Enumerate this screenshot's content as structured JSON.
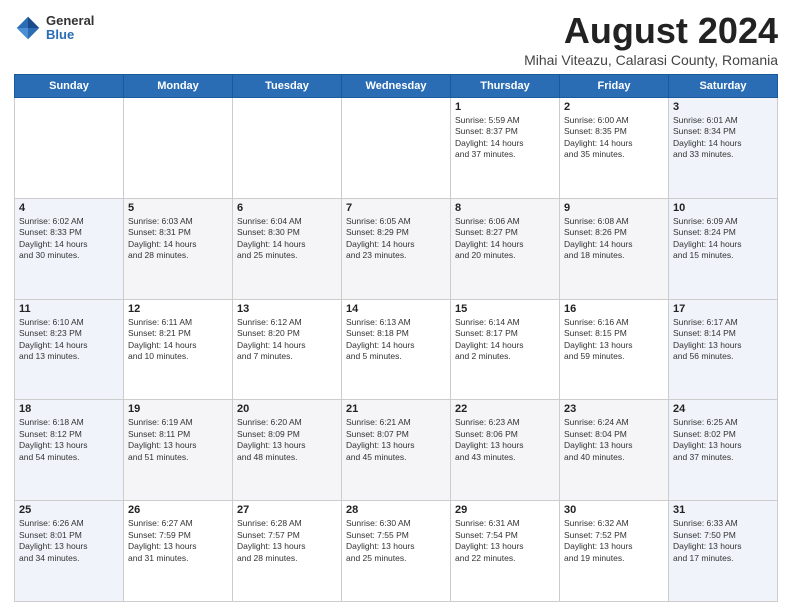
{
  "logo": {
    "general": "General",
    "blue": "Blue"
  },
  "title": "August 2024",
  "subtitle": "Mihai Viteazu, Calarasi County, Romania",
  "headers": [
    "Sunday",
    "Monday",
    "Tuesday",
    "Wednesday",
    "Thursday",
    "Friday",
    "Saturday"
  ],
  "weeks": [
    [
      {
        "day": "",
        "info": ""
      },
      {
        "day": "",
        "info": ""
      },
      {
        "day": "",
        "info": ""
      },
      {
        "day": "",
        "info": ""
      },
      {
        "day": "1",
        "info": "Sunrise: 5:59 AM\nSunset: 8:37 PM\nDaylight: 14 hours\nand 37 minutes."
      },
      {
        "day": "2",
        "info": "Sunrise: 6:00 AM\nSunset: 8:35 PM\nDaylight: 14 hours\nand 35 minutes."
      },
      {
        "day": "3",
        "info": "Sunrise: 6:01 AM\nSunset: 8:34 PM\nDaylight: 14 hours\nand 33 minutes."
      }
    ],
    [
      {
        "day": "4",
        "info": "Sunrise: 6:02 AM\nSunset: 8:33 PM\nDaylight: 14 hours\nand 30 minutes."
      },
      {
        "day": "5",
        "info": "Sunrise: 6:03 AM\nSunset: 8:31 PM\nDaylight: 14 hours\nand 28 minutes."
      },
      {
        "day": "6",
        "info": "Sunrise: 6:04 AM\nSunset: 8:30 PM\nDaylight: 14 hours\nand 25 minutes."
      },
      {
        "day": "7",
        "info": "Sunrise: 6:05 AM\nSunset: 8:29 PM\nDaylight: 14 hours\nand 23 minutes."
      },
      {
        "day": "8",
        "info": "Sunrise: 6:06 AM\nSunset: 8:27 PM\nDaylight: 14 hours\nand 20 minutes."
      },
      {
        "day": "9",
        "info": "Sunrise: 6:08 AM\nSunset: 8:26 PM\nDaylight: 14 hours\nand 18 minutes."
      },
      {
        "day": "10",
        "info": "Sunrise: 6:09 AM\nSunset: 8:24 PM\nDaylight: 14 hours\nand 15 minutes."
      }
    ],
    [
      {
        "day": "11",
        "info": "Sunrise: 6:10 AM\nSunset: 8:23 PM\nDaylight: 14 hours\nand 13 minutes."
      },
      {
        "day": "12",
        "info": "Sunrise: 6:11 AM\nSunset: 8:21 PM\nDaylight: 14 hours\nand 10 minutes."
      },
      {
        "day": "13",
        "info": "Sunrise: 6:12 AM\nSunset: 8:20 PM\nDaylight: 14 hours\nand 7 minutes."
      },
      {
        "day": "14",
        "info": "Sunrise: 6:13 AM\nSunset: 8:18 PM\nDaylight: 14 hours\nand 5 minutes."
      },
      {
        "day": "15",
        "info": "Sunrise: 6:14 AM\nSunset: 8:17 PM\nDaylight: 14 hours\nand 2 minutes."
      },
      {
        "day": "16",
        "info": "Sunrise: 6:16 AM\nSunset: 8:15 PM\nDaylight: 13 hours\nand 59 minutes."
      },
      {
        "day": "17",
        "info": "Sunrise: 6:17 AM\nSunset: 8:14 PM\nDaylight: 13 hours\nand 56 minutes."
      }
    ],
    [
      {
        "day": "18",
        "info": "Sunrise: 6:18 AM\nSunset: 8:12 PM\nDaylight: 13 hours\nand 54 minutes."
      },
      {
        "day": "19",
        "info": "Sunrise: 6:19 AM\nSunset: 8:11 PM\nDaylight: 13 hours\nand 51 minutes."
      },
      {
        "day": "20",
        "info": "Sunrise: 6:20 AM\nSunset: 8:09 PM\nDaylight: 13 hours\nand 48 minutes."
      },
      {
        "day": "21",
        "info": "Sunrise: 6:21 AM\nSunset: 8:07 PM\nDaylight: 13 hours\nand 45 minutes."
      },
      {
        "day": "22",
        "info": "Sunrise: 6:23 AM\nSunset: 8:06 PM\nDaylight: 13 hours\nand 43 minutes."
      },
      {
        "day": "23",
        "info": "Sunrise: 6:24 AM\nSunset: 8:04 PM\nDaylight: 13 hours\nand 40 minutes."
      },
      {
        "day": "24",
        "info": "Sunrise: 6:25 AM\nSunset: 8:02 PM\nDaylight: 13 hours\nand 37 minutes."
      }
    ],
    [
      {
        "day": "25",
        "info": "Sunrise: 6:26 AM\nSunset: 8:01 PM\nDaylight: 13 hours\nand 34 minutes."
      },
      {
        "day": "26",
        "info": "Sunrise: 6:27 AM\nSunset: 7:59 PM\nDaylight: 13 hours\nand 31 minutes."
      },
      {
        "day": "27",
        "info": "Sunrise: 6:28 AM\nSunset: 7:57 PM\nDaylight: 13 hours\nand 28 minutes."
      },
      {
        "day": "28",
        "info": "Sunrise: 6:30 AM\nSunset: 7:55 PM\nDaylight: 13 hours\nand 25 minutes."
      },
      {
        "day": "29",
        "info": "Sunrise: 6:31 AM\nSunset: 7:54 PM\nDaylight: 13 hours\nand 22 minutes."
      },
      {
        "day": "30",
        "info": "Sunrise: 6:32 AM\nSunset: 7:52 PM\nDaylight: 13 hours\nand 19 minutes."
      },
      {
        "day": "31",
        "info": "Sunrise: 6:33 AM\nSunset: 7:50 PM\nDaylight: 13 hours\nand 17 minutes."
      }
    ]
  ]
}
